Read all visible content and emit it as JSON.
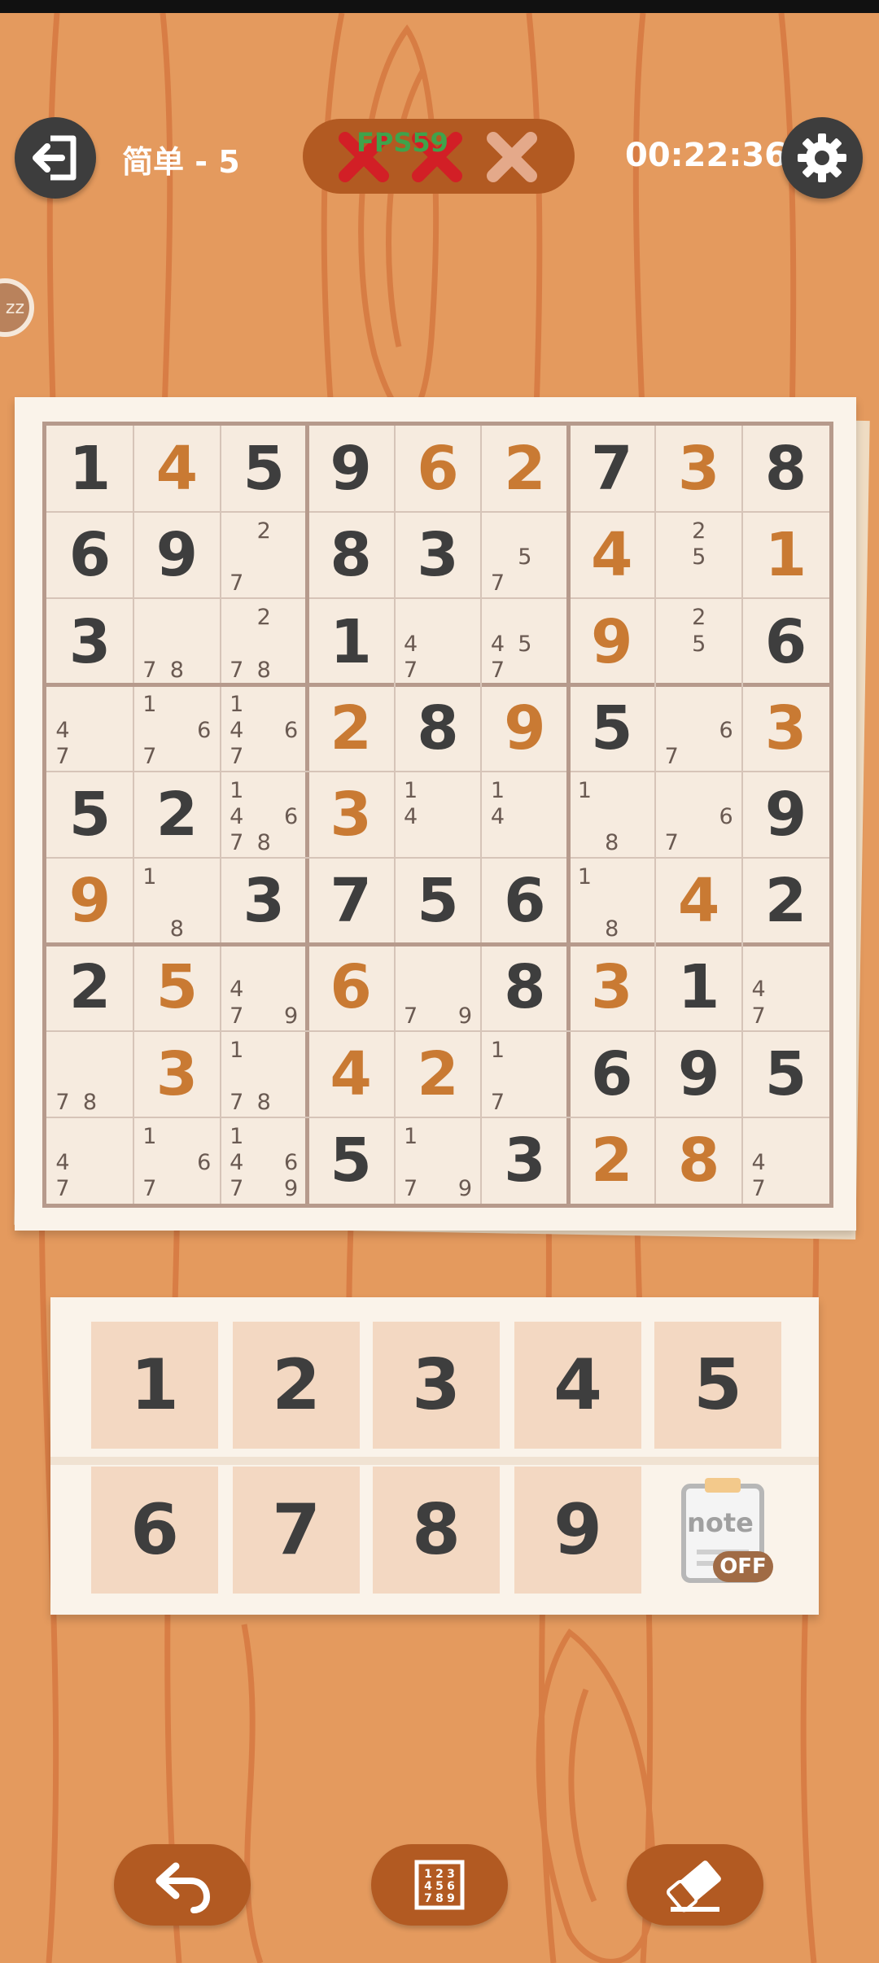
{
  "header": {
    "level": "简单 - 5",
    "timer": "00:22:36",
    "fps": "FPS59",
    "mistakes": [
      "used",
      "used",
      "unused"
    ]
  },
  "side_badge": "zz",
  "board": {
    "cells": [
      [
        {
          "v": "1",
          "t": "g"
        },
        {
          "v": "4",
          "t": "u"
        },
        {
          "v": "5",
          "t": "g"
        },
        {
          "v": "9",
          "t": "g"
        },
        {
          "v": "6",
          "t": "u"
        },
        {
          "v": "2",
          "t": "u"
        },
        {
          "v": "7",
          "t": "g"
        },
        {
          "v": "3",
          "t": "u"
        },
        {
          "v": "8",
          "t": "g"
        }
      ],
      [
        {
          "v": "6",
          "t": "g"
        },
        {
          "v": "9",
          "t": "g"
        },
        {
          "n": [
            2,
            7
          ]
        },
        {
          "v": "8",
          "t": "g"
        },
        {
          "v": "3",
          "t": "g"
        },
        {
          "n": [
            5,
            7
          ]
        },
        {
          "v": "4",
          "t": "u"
        },
        {
          "n": [
            2,
            5
          ]
        },
        {
          "v": "1",
          "t": "u"
        }
      ],
      [
        {
          "v": "3",
          "t": "g"
        },
        {
          "n": [
            7,
            8
          ]
        },
        {
          "n": [
            2,
            7,
            8
          ]
        },
        {
          "v": "1",
          "t": "g"
        },
        {
          "n": [
            4,
            7
          ]
        },
        {
          "n": [
            4,
            5,
            7
          ]
        },
        {
          "v": "9",
          "t": "u"
        },
        {
          "n": [
            2,
            5
          ]
        },
        {
          "v": "6",
          "t": "g"
        }
      ],
      [
        {
          "n": [
            4,
            7
          ]
        },
        {
          "n": [
            1,
            6,
            7
          ]
        },
        {
          "n": [
            1,
            4,
            6,
            7
          ]
        },
        {
          "v": "2",
          "t": "u"
        },
        {
          "v": "8",
          "t": "g"
        },
        {
          "v": "9",
          "t": "u"
        },
        {
          "v": "5",
          "t": "g"
        },
        {
          "n": [
            6,
            7
          ]
        },
        {
          "v": "3",
          "t": "u"
        }
      ],
      [
        {
          "v": "5",
          "t": "g"
        },
        {
          "v": "2",
          "t": "g"
        },
        {
          "n": [
            1,
            4,
            6,
            7,
            8
          ]
        },
        {
          "v": "3",
          "t": "u"
        },
        {
          "n": [
            1,
            4
          ]
        },
        {
          "n": [
            1,
            4
          ]
        },
        {
          "n": [
            1,
            8
          ]
        },
        {
          "n": [
            6,
            7
          ]
        },
        {
          "v": "9",
          "t": "g"
        }
      ],
      [
        {
          "v": "9",
          "t": "u"
        },
        {
          "n": [
            1,
            8
          ]
        },
        {
          "v": "3",
          "t": "g"
        },
        {
          "v": "7",
          "t": "g"
        },
        {
          "v": "5",
          "t": "g"
        },
        {
          "v": "6",
          "t": "g"
        },
        {
          "n": [
            1,
            8
          ]
        },
        {
          "v": "4",
          "t": "u"
        },
        {
          "v": "2",
          "t": "g"
        }
      ],
      [
        {
          "v": "2",
          "t": "g"
        },
        {
          "v": "5",
          "t": "u"
        },
        {
          "n": [
            4,
            7,
            9
          ]
        },
        {
          "v": "6",
          "t": "u"
        },
        {
          "n": [
            7,
            9
          ]
        },
        {
          "v": "8",
          "t": "g"
        },
        {
          "v": "3",
          "t": "u"
        },
        {
          "v": "1",
          "t": "g"
        },
        {
          "n": [
            4,
            7
          ]
        }
      ],
      [
        {
          "n": [
            7,
            8
          ]
        },
        {
          "v": "3",
          "t": "u"
        },
        {
          "n": [
            1,
            7,
            8
          ]
        },
        {
          "v": "4",
          "t": "u"
        },
        {
          "v": "2",
          "t": "u"
        },
        {
          "n": [
            1,
            7
          ]
        },
        {
          "v": "6",
          "t": "g"
        },
        {
          "v": "9",
          "t": "g"
        },
        {
          "v": "5",
          "t": "g"
        }
      ],
      [
        {
          "n": [
            4,
            7
          ]
        },
        {
          "n": [
            1,
            6,
            7
          ]
        },
        {
          "n": [
            1,
            4,
            6,
            7,
            9
          ]
        },
        {
          "v": "5",
          "t": "g"
        },
        {
          "n": [
            1,
            7,
            9
          ]
        },
        {
          "v": "3",
          "t": "g"
        },
        {
          "v": "2",
          "t": "u"
        },
        {
          "v": "8",
          "t": "u"
        },
        {
          "n": [
            4,
            7
          ]
        }
      ]
    ]
  },
  "numpad": [
    "1",
    "2",
    "3",
    "4",
    "5",
    "6",
    "7",
    "8",
    "9"
  ],
  "note_toggle": {
    "label": "note",
    "state": "OFF"
  },
  "icons": {
    "exit": "exit-icon",
    "settings": "gear-icon",
    "undo": "undo-icon",
    "grid": "number-grid-icon",
    "erase": "eraser-icon"
  },
  "colors": {
    "background": "#e49a5e",
    "given_digit": "#3e3e3e",
    "user_digit": "#c97a33",
    "mistake_used": "#d21f26",
    "mistake_unused": "#e4a98a",
    "accent": "#b25a22"
  }
}
